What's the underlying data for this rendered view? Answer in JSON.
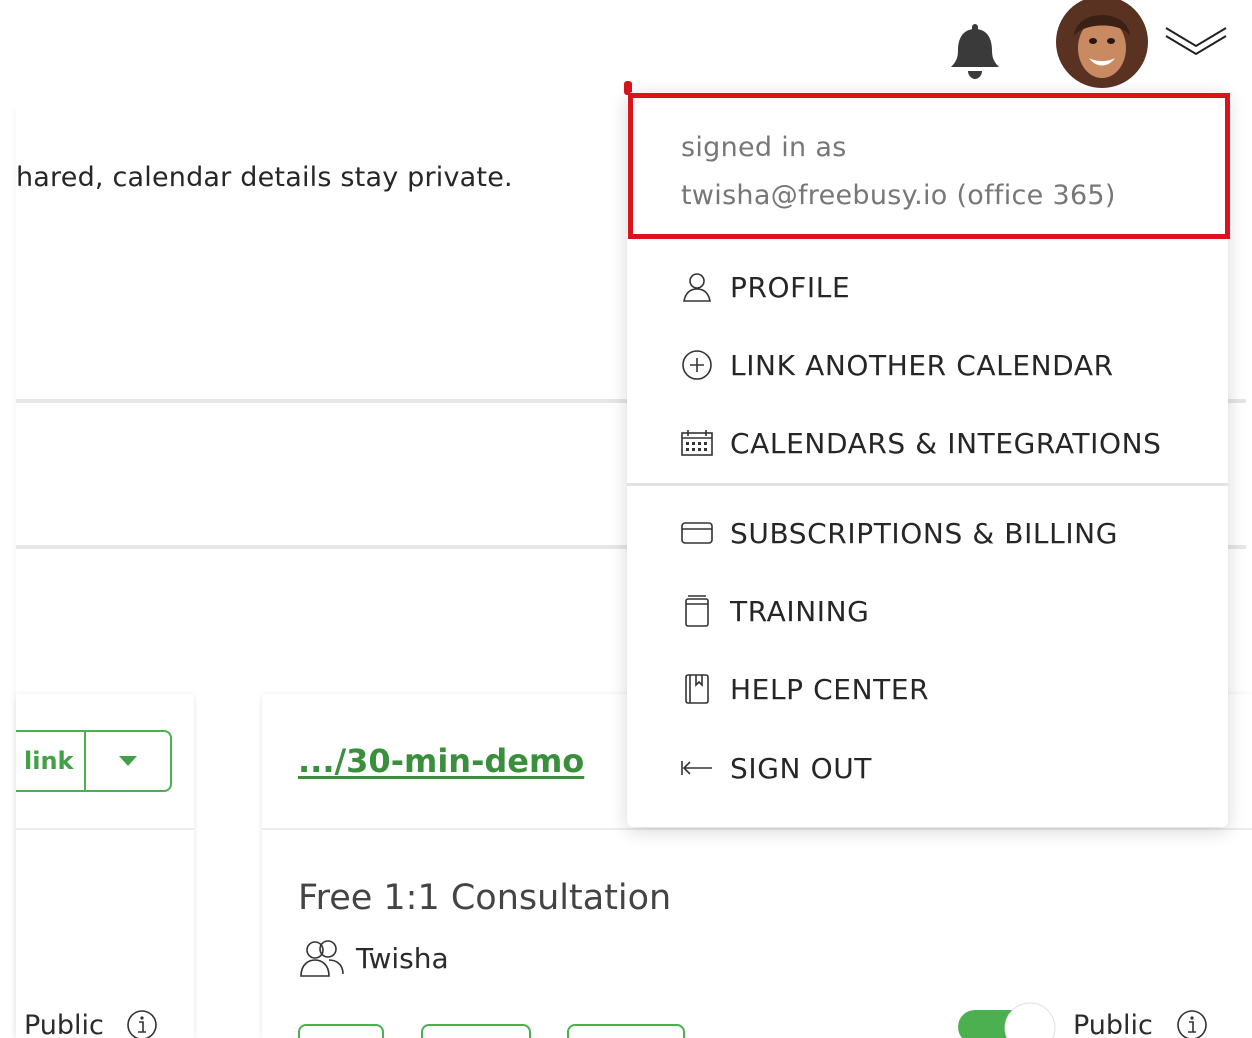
{
  "header": {
    "notifications_icon": "bell-icon",
    "avatar_icon": "user-avatar",
    "menu_toggle_icon": "double-chevron-down-icon"
  },
  "page": {
    "intro_text": "hared, calendar details stay private.",
    "left_card": {
      "link_button_label": "link",
      "public_label": "Public"
    },
    "event_card": {
      "link_text": ".../30-min-demo",
      "title": "Free 1:1 Consultation",
      "host": "Twisha",
      "public_label": "Public",
      "toggle_on": true
    }
  },
  "account_menu": {
    "signed_in_label": "signed in as",
    "signed_in_account": "twisha@freebusy.io (office 365)",
    "highlight_color": "#d9141c",
    "items": [
      {
        "label": "PROFILE",
        "icon": "person-icon"
      },
      {
        "label": "LINK ANOTHER CALENDAR",
        "icon": "plus-circle-icon"
      },
      {
        "label": "CALENDARS & INTEGRATIONS",
        "icon": "calendar-icon"
      },
      {
        "label": "SUBSCRIPTIONS & BILLING",
        "icon": "credit-card-icon"
      },
      {
        "label": "TRAINING",
        "icon": "notebook-icon"
      },
      {
        "label": "HELP CENTER",
        "icon": "book-icon"
      },
      {
        "label": "SIGN OUT",
        "icon": "sign-out-arrow-icon"
      }
    ]
  },
  "colors": {
    "accent_green": "#4caf50",
    "link_green": "#3a8f3d",
    "text_dark": "#262626",
    "text_muted": "#777777"
  }
}
